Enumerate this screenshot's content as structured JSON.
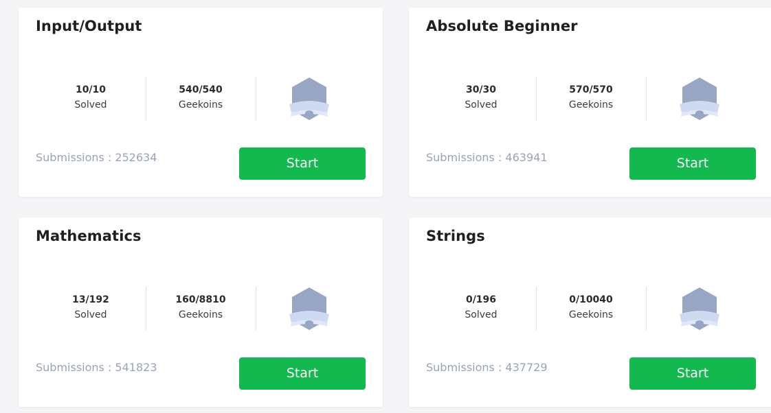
{
  "colors": {
    "page_bg": "#f5f5f7",
    "card_bg": "#ffffff",
    "start_button": "#13b84f",
    "badge_primary": "#98a6c3",
    "badge_ribbon": "#cfd9f1",
    "muted_text": "#9aa3b5"
  },
  "cards": [
    {
      "title": "Input/Output",
      "solved_value": "10/10",
      "solved_label": "Solved",
      "geekoins_value": "540/540",
      "geekoins_label": "Geekoins",
      "badge_icon": "badge-icon",
      "submissions": "Submissions : 252634",
      "start_label": "Start"
    },
    {
      "title": "Absolute Beginner",
      "solved_value": "30/30",
      "solved_label": "Solved",
      "geekoins_value": "570/570",
      "geekoins_label": "Geekoins",
      "badge_icon": "badge-icon",
      "submissions": "Submissions : 463941",
      "start_label": "Start"
    },
    {
      "title": "Mathematics",
      "solved_value": "13/192",
      "solved_label": "Solved",
      "geekoins_value": "160/8810",
      "geekoins_label": "Geekoins",
      "badge_icon": "badge-icon",
      "submissions": "Submissions : 541823",
      "start_label": "Start"
    },
    {
      "title": "Strings",
      "solved_value": "0/196",
      "solved_label": "Solved",
      "geekoins_value": "0/10040",
      "geekoins_label": "Geekoins",
      "badge_icon": "badge-icon",
      "submissions": "Submissions : 437729",
      "start_label": "Start"
    }
  ]
}
